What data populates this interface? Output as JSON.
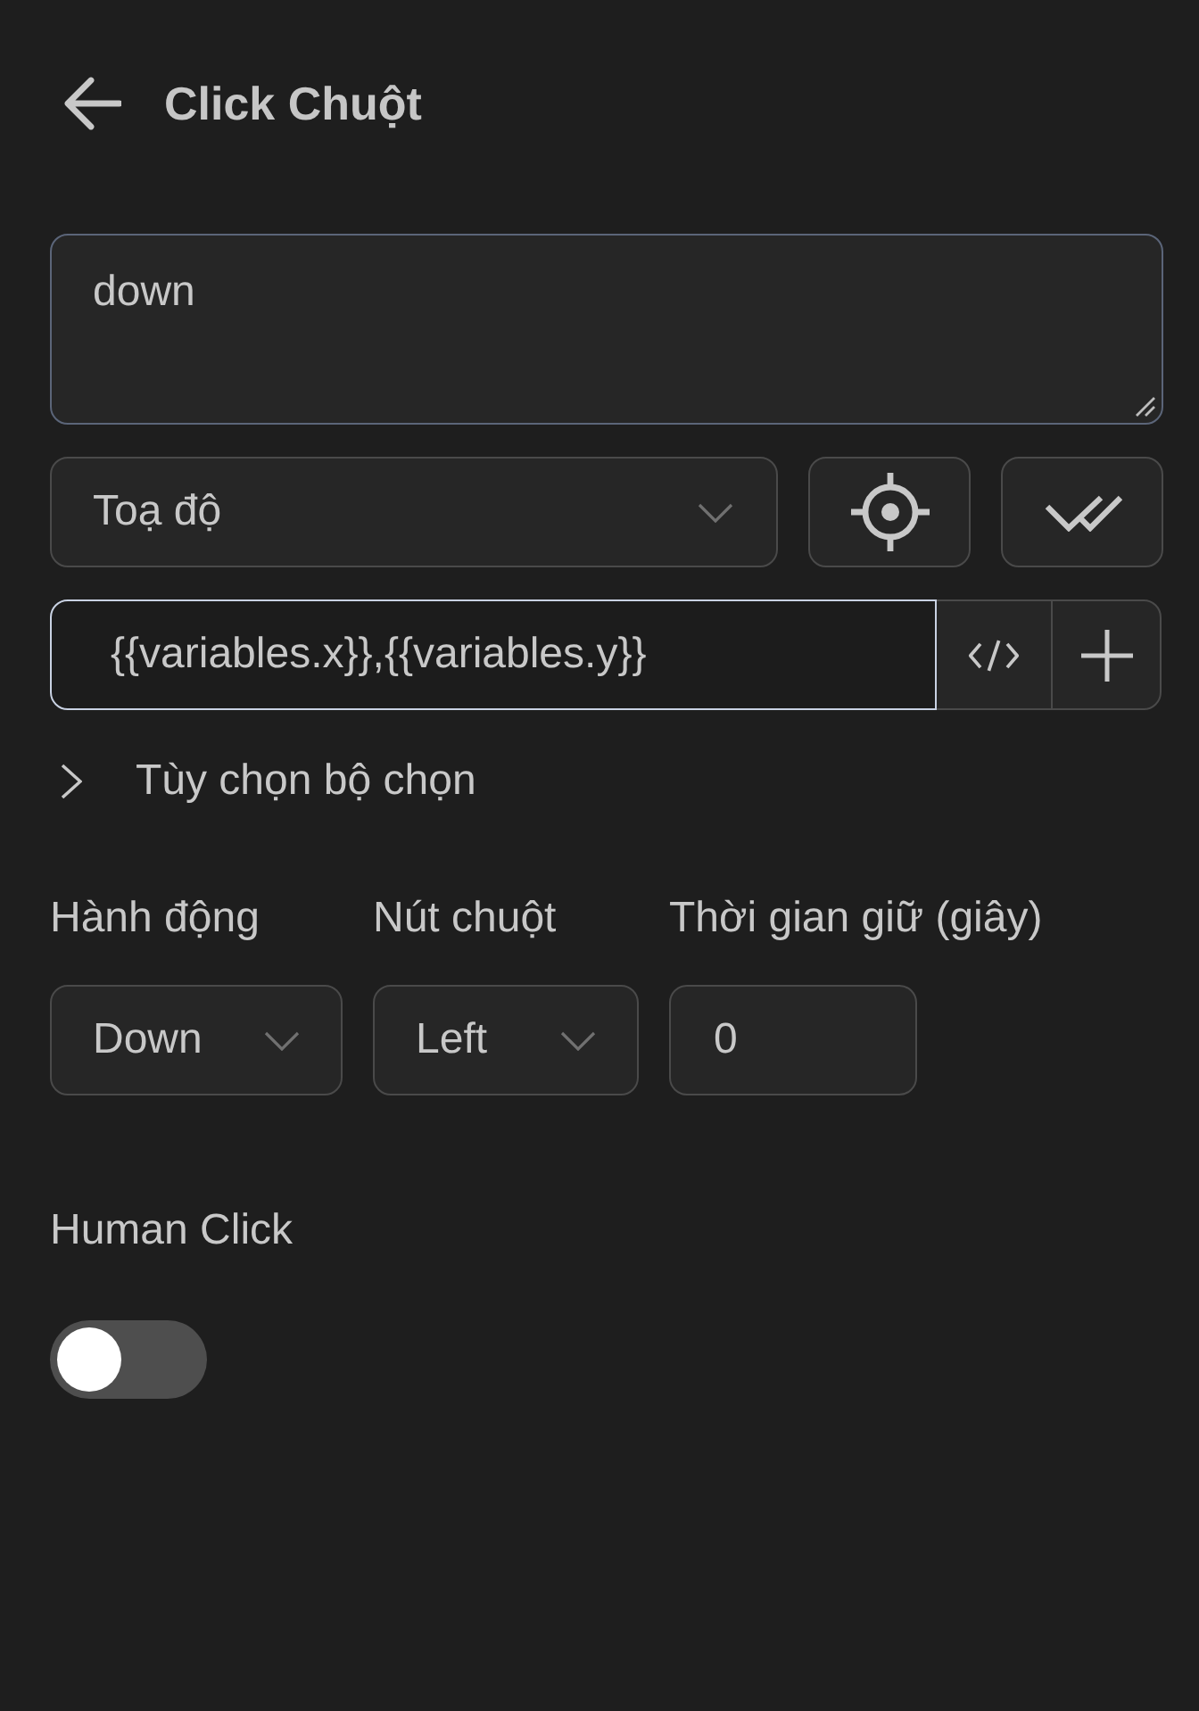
{
  "header": {
    "title": "Click Chuột"
  },
  "note_field": {
    "value": "down"
  },
  "target_select": {
    "value": "Toạ độ"
  },
  "selector_input": {
    "value": "{{variables.x}},{{variables.y}}",
    "focused": true
  },
  "selector_options": {
    "label": "Tùy chọn bộ chọn",
    "expanded": false
  },
  "params": [
    {
      "kind": "select",
      "label": "Hành động",
      "value": "Down"
    },
    {
      "kind": "select",
      "label": "Nút chuột",
      "value": "Left"
    },
    {
      "kind": "input",
      "label": "Thời gian giữ (giây)",
      "value": "0"
    }
  ],
  "human_click": {
    "label": "Human Click",
    "on": false
  }
}
